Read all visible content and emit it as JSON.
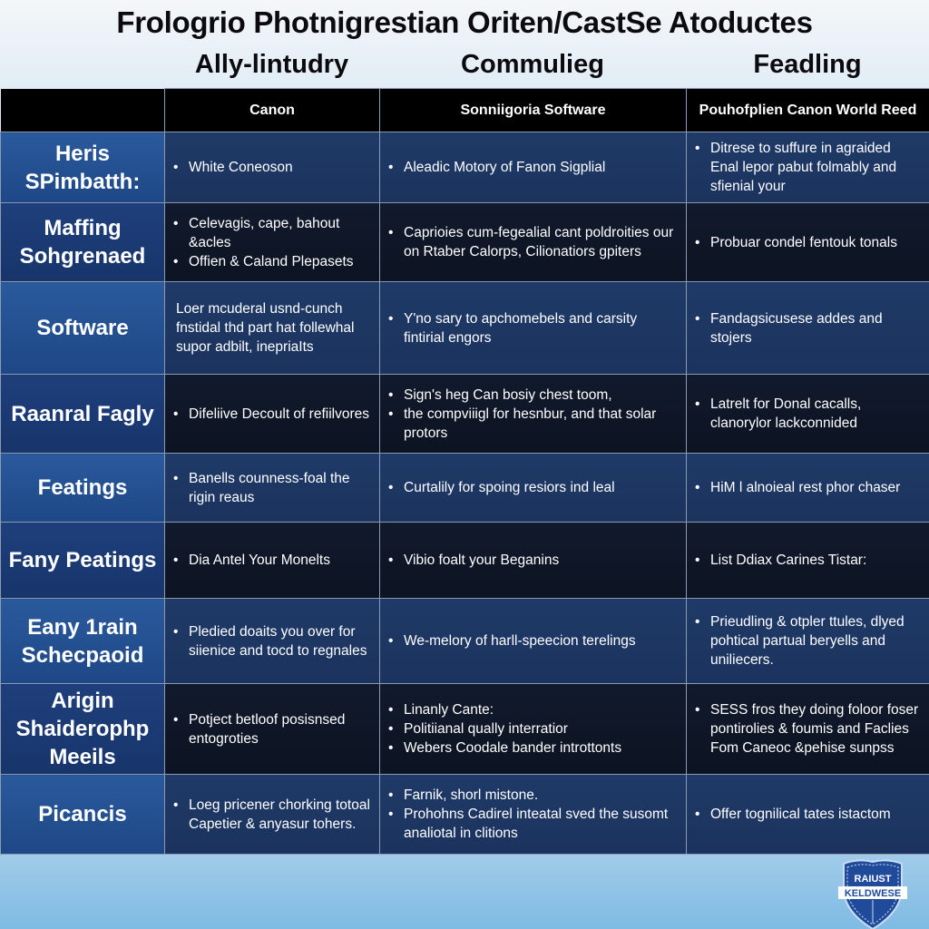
{
  "title": "Frologrio Photnigrestian Oriten/CastSe Atoductes",
  "groups": [
    "Ally-lintudry",
    "Commulieg",
    "Feadling"
  ],
  "columns": [
    "Canon",
    "Sonniigoria Software",
    "Pouhofplien Canon World Reed"
  ],
  "rows": [
    {
      "label": "Heris SPimbatth:",
      "cells": [
        {
          "bullets": [
            "White Coneoson"
          ]
        },
        {
          "bullets": [
            "Aleadic Motory of Fanon Sigplial"
          ]
        },
        {
          "bullets": [
            "Ditrese to suffure in agraided Enal lepor pabut folmably and sfienial your"
          ]
        }
      ]
    },
    {
      "label": "Maffing Sohgrenaed",
      "cells": [
        {
          "bullets": [
            "Celevagis, cape, bahout &acles",
            "Offien & Caland Plepasets"
          ]
        },
        {
          "bullets": [
            "Caprioies cum-fegealial cant poldroities our on Rtaber Calorps, Cilionatiors gpiters"
          ]
        },
        {
          "bullets": [
            "Probuar condel fentouk tonals"
          ]
        }
      ]
    },
    {
      "label": "Software",
      "cells": [
        {
          "text": "Loer mcuderal usnd-cunch fnstidal thd part hat follewhal supor adbilt, inepriaIts"
        },
        {
          "bullets": [
            "Y'no sary to apchomebels and carsity fintirial engors"
          ]
        },
        {
          "bullets": [
            "Fandagsicusese addes and stojers"
          ]
        }
      ]
    },
    {
      "label": "Raanral Fagly",
      "cells": [
        {
          "bullets": [
            "Difeliive Decoult of refiilvores"
          ]
        },
        {
          "bullets": [
            "Sign's heg Can bosiy chest toom,",
            "the compviiigl for hesnbur, and that solar protors"
          ]
        },
        {
          "bullets": [
            "Latrelt for Donal cacalls, clanorylor lackconnided"
          ]
        }
      ]
    },
    {
      "label": "Featings",
      "cells": [
        {
          "bullets": [
            "Banells counness-foal the rigin reaus"
          ]
        },
        {
          "bullets": [
            "Curtalily for spoing resiors ind leal"
          ]
        },
        {
          "bullets": [
            "HiM l alnoieal rest phor chaser"
          ]
        }
      ]
    },
    {
      "label": "Fany Peatings",
      "cells": [
        {
          "bullets": [
            "Dia Antel Your Monelts"
          ]
        },
        {
          "bullets": [
            "Vibio foalt your Beganins"
          ]
        },
        {
          "bullets": [
            "List Ddiax Carines Tistar:"
          ]
        }
      ]
    },
    {
      "label": "Eany 1rain Schecpaoid",
      "cells": [
        {
          "bullets": [
            "Pledied doaits you over for siienice and tocd to regnales"
          ]
        },
        {
          "bullets": [
            "We-melory of harll-speecion terelings"
          ]
        },
        {
          "bullets": [
            "Prieudling & otpler ttules, dlyed pohtical partual beryells and uniliecers."
          ]
        }
      ]
    },
    {
      "label": "Arigin Shaiderophp Meeils",
      "cells": [
        {
          "bullets": [
            "Potject betloof posisnsed entogroties"
          ]
        },
        {
          "bullets": [
            "Linanly Cante:",
            "Politiianal qually interratior",
            "Webers Coodale bander introttonts"
          ]
        },
        {
          "bullets": [
            "SESS fros they doing foloor foser pontirolies & foumis and Faclies Fom Caneoc &pehise sunpss"
          ]
        }
      ]
    },
    {
      "label": "Picancis",
      "cells": [
        {
          "bullets": [
            "Loeg pricener chorking totoal Capetier & anyasur tohers."
          ]
        },
        {
          "bullets": [
            "Farnik, shorl mistone.",
            "Prohohns Cadirel inteatal sved the susomt analiotal in clitions"
          ]
        },
        {
          "bullets": [
            "Offer tognilical tates istactom"
          ]
        }
      ]
    }
  ],
  "badge": {
    "line1": "RAIUST",
    "line2": "KELDWESE",
    "colors": {
      "fill": "#1f4b9a",
      "banner": "#ffffff",
      "text": "#ffffff"
    }
  },
  "colors": {
    "header_bg": "#000000",
    "rowhead_bg": "#2a5a9c",
    "cell_light": "#1f3a68",
    "cell_dark": "#0e1627",
    "grid_line": "#8a9bb3"
  }
}
